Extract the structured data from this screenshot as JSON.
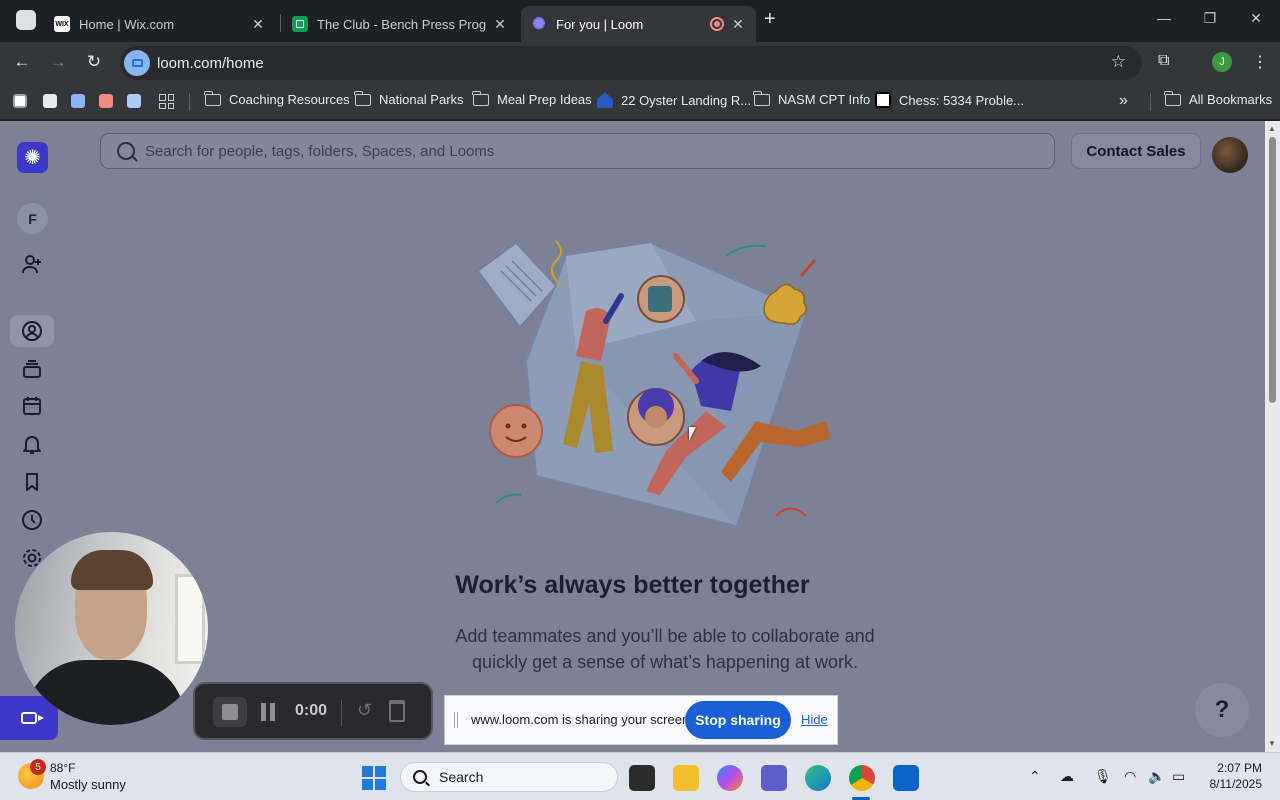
{
  "browser": {
    "tabs": [
      {
        "title": "Home | Wix.com",
        "favicon_text": "WIX",
        "favicon_color": "#ffffff"
      },
      {
        "title": "The Club - Bench Press Program",
        "favicon_color": "#0f9d58"
      },
      {
        "title": "For you | Loom",
        "favicon_color": "#625df5",
        "active": true,
        "recording": true
      }
    ],
    "url": "loom.com/home",
    "profile_initial": "J",
    "bookmarks": [
      {
        "label": "Coaching Resources",
        "type": "folder"
      },
      {
        "label": "National Parks",
        "type": "folder"
      },
      {
        "label": "Meal Prep Ideas",
        "type": "folder"
      },
      {
        "label": "22 Oyster Landing R...",
        "type": "site"
      },
      {
        "label": "NASM CPT Info",
        "type": "folder"
      },
      {
        "label": "Chess: 5334 Proble...",
        "type": "site"
      }
    ],
    "all_bookmarks": "All Bookmarks"
  },
  "loom": {
    "workspace_initial": "F",
    "search_placeholder": "Search for people, tags, folders, Spaces, and Looms",
    "contact_sales": "Contact Sales",
    "headline": "Work’s always better together",
    "subtext": "Add teammates and you’ll be able to collaborate and quickly get a sense of what’s happening at work.",
    "help_label": "?",
    "sidebar_icons": [
      "add-member-icon",
      "for-you-icon",
      "library-icon",
      "calendar-icon",
      "notifications-icon",
      "bookmark-icon",
      "history-icon",
      "settings-icon"
    ],
    "accent": "#3d38c9"
  },
  "recorder": {
    "timer": "0:00"
  },
  "share_bar": {
    "message": "www.loom.com is sharing your screen.",
    "stop_label": "Stop sharing",
    "hide_label": "Hide"
  },
  "taskbar": {
    "weather_badge": "5",
    "temperature": "88°F",
    "condition": "Mostly sunny",
    "search_label": "Search",
    "time": "2:07 PM",
    "date": "8/11/2025"
  }
}
